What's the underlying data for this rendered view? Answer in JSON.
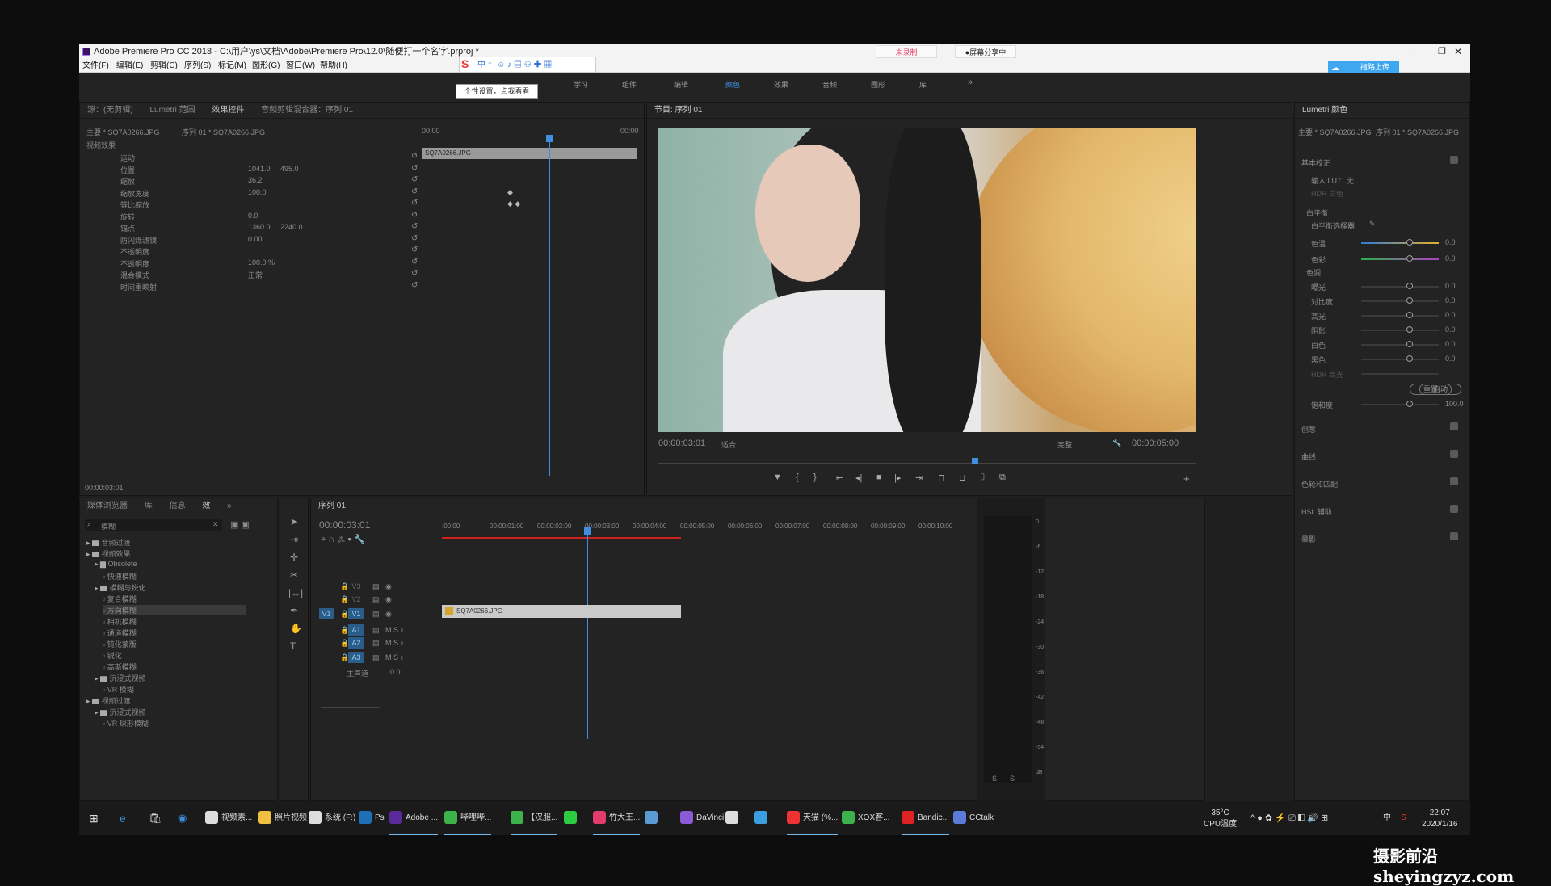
{
  "window": {
    "title": "Adobe Premiere Pro CC 2018 - C:\\用户\\ys\\文档\\Adobe\\Premiere Pro\\12.0\\随便打一个名字.prproj *",
    "btn_unrecorded": "未录制",
    "btn_sharing": "●屏幕分享中",
    "upload_label": "拖路上传"
  },
  "menu": [
    "文件(F)",
    "编辑(E)",
    "剪辑(C)",
    "序列(S)",
    "标记(M)",
    "图形(G)",
    "窗口(W)",
    "帮助(H)"
  ],
  "ime": {
    "tooltip": "个性设置，点我看看"
  },
  "workspaces": [
    "学习",
    "组件",
    "编辑",
    "颜色",
    "效果",
    "音频",
    "图形",
    "库",
    "»"
  ],
  "effect_controls": {
    "tabs": [
      "源：(无剪辑)",
      "Lumetri 范围",
      "效果控件",
      "音频剪辑混合器：序列 01"
    ],
    "active_tab": "效果控件",
    "clip_path": "主要 * SQ7A0266.JPG",
    "seq_path": "序列 01 * SQ7A0266.JPG",
    "ruler_start": "00:00",
    "ruler_end": "00:00",
    "clip_label": "SQ7A0266.JPG",
    "section_video": "视频效果",
    "rows": [
      {
        "label": "运动",
        "v1": "",
        "v2": ""
      },
      {
        "label": "位置",
        "v1": "1041.0",
        "v2": "495.0"
      },
      {
        "label": "缩放",
        "v1": "36.2",
        "v2": ""
      },
      {
        "label": "缩放宽度",
        "v1": "100.0",
        "v2": ""
      },
      {
        "label": "等比缩放",
        "v1": "",
        "v2": ""
      },
      {
        "label": "旋转",
        "v1": "0.0",
        "v2": ""
      },
      {
        "label": "锚点",
        "v1": "1360.0",
        "v2": "2240.0"
      },
      {
        "label": "防闪烁滤镜",
        "v1": "0.00",
        "v2": ""
      },
      {
        "label": "不透明度",
        "v1": "",
        "v2": ""
      },
      {
        "label": "不透明度",
        "v1": "100.0 %",
        "v2": ""
      },
      {
        "label": "混合模式",
        "v1": "正常",
        "v2": ""
      },
      {
        "label": "时间重映射",
        "v1": "",
        "v2": ""
      }
    ],
    "timecode": "00:00:03:01"
  },
  "program": {
    "tab": "节目: 序列 01",
    "timecode": "00:00:03:01",
    "fit": "适合",
    "quality": "完整",
    "duration": "00:00:05:00"
  },
  "lumetri": {
    "tab": "Lumetri 颜色",
    "path": "主要 * SQ7A0266.JPG",
    "seq": "序列 01 * SQ7A0266.JPG",
    "basic": "基本校正",
    "input_lut": "输入 LUT",
    "lut_value": "无",
    "hdr_white": "HDR 白色",
    "wb_section": "白平衡",
    "wb_selector": "白平衡选择器",
    "wb_sliders": [
      {
        "label": "色温",
        "value": "0.0"
      },
      {
        "label": "色彩",
        "value": "0.0"
      }
    ],
    "tone_section": "色调",
    "tone_sliders": [
      {
        "label": "曝光",
        "value": "0.0"
      },
      {
        "label": "对比度",
        "value": "0.0"
      },
      {
        "label": "高光",
        "value": "0.0"
      },
      {
        "label": "阴影",
        "value": "0.0"
      },
      {
        "label": "白色",
        "value": "0.0"
      },
      {
        "label": "黑色",
        "value": "0.0"
      },
      {
        "label": "HDR 高光",
        "value": ""
      }
    ],
    "reset": "重置",
    "auto": "自动",
    "saturation": {
      "label": "饱和度",
      "value": "100.0"
    },
    "sections": [
      "创意",
      "曲线",
      "色轮和匹配",
      "HSL 辅助",
      "晕影"
    ]
  },
  "media_browser": {
    "tabs": [
      "媒体浏览器",
      "库",
      "信息",
      "效",
      "»"
    ],
    "search": "模糊",
    "tree": [
      "音频过渡",
      "视频效果",
      "Obsolete",
      "快速模糊",
      "模糊与锐化",
      "复合模糊",
      "方向模糊",
      "相机模糊",
      "通道模糊",
      "钝化蒙版",
      "锐化",
      "高斯模糊",
      "沉浸式视频",
      "VR 模糊",
      "视频过渡",
      "沉浸式视频",
      "VR 球形模糊"
    ]
  },
  "timeline": {
    "tab": "序列 01",
    "timecode": "00:00:03:01",
    "ruler": [
      ":00:00",
      "00:00:01:00",
      "00:00:02:00",
      "00:00:03:00",
      "00:00:04:00",
      "00:00:05:00",
      "00:00:06:00",
      "00:00:07:00",
      "00:00:08:00",
      "00:00:09:00",
      "00:00:10:00"
    ],
    "tracks": [
      "V3",
      "V2",
      "V1",
      "A1",
      "A2",
      "A3"
    ],
    "master": "主声道",
    "master_value": "0.0",
    "clip": "SQ7A0266.JPG",
    "meter_labels": [
      "0",
      "-6",
      "-12",
      "-18",
      "-24",
      "-30",
      "-36",
      "-42",
      "-48",
      "-54",
      "dB"
    ],
    "meter_bottom": [
      "S",
      "S"
    ]
  },
  "taskbar": {
    "items": [
      "视频素...",
      "照片视频",
      "系统 (F:)",
      "Ps",
      "Adobe ...",
      "哔哩哔...",
      "【汉服...",
      "",
      "竹大王...",
      "",
      "DaVinci...",
      "",
      "",
      "天猫 (%...",
      "XOX客...",
      "Bandic...",
      "CCtalk"
    ],
    "temp": "35°C",
    "cpu": "CPU温度",
    "ime": "中",
    "time": "22:07",
    "date": "2020/1/16"
  },
  "watermark": "摄影前沿 sheyingzyz.com",
  "colors": {
    "accent": "#2d8ceb",
    "bg": "#1f1f1f",
    "clip": "#c9c9c9",
    "playhead": "#4a9eff"
  }
}
